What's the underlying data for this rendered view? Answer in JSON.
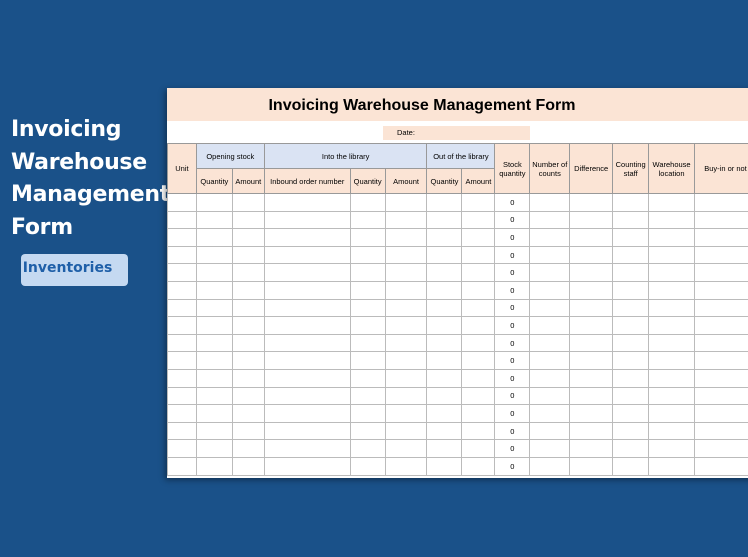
{
  "side": {
    "title_lines": [
      "Invoicing",
      "Warehouse",
      "Management",
      "Form"
    ],
    "tag": "Inventories"
  },
  "sheet": {
    "title": "Invoicing Warehouse Management Form",
    "date_label": "Date:",
    "headers": {
      "unit": "Unit",
      "opening_stock": "Opening stock",
      "into_library": "Into the library",
      "out_library": "Out of the library",
      "stock_quantity": "Stock quantity",
      "number_of_counts": "Number of counts",
      "difference": "Difference",
      "counting_staff": "Counting staff",
      "warehouse_location": "Warehouse location",
      "buy_in": "Buy-in or not",
      "quantity": "Quantity",
      "amount": "Amount",
      "inbound_order_number": "Inbound order number"
    },
    "stock_values": [
      "0",
      "0",
      "0",
      "0",
      "0",
      "0",
      "0",
      "0",
      "0",
      "0",
      "0",
      "0",
      "0",
      "0",
      "0",
      "0"
    ]
  }
}
